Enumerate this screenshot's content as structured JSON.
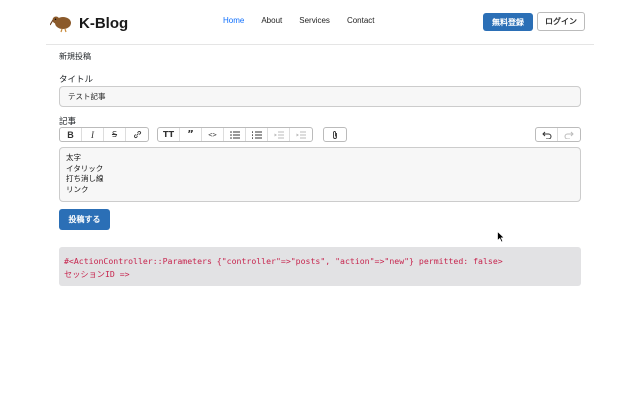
{
  "brand": {
    "name": "K-Blog",
    "logo_icon": "kiwi-bird-icon"
  },
  "nav": {
    "items": [
      {
        "label": "Home",
        "active": true
      },
      {
        "label": "About",
        "active": false
      },
      {
        "label": "Services",
        "active": false
      },
      {
        "label": "Contact",
        "active": false
      }
    ]
  },
  "auth": {
    "signup_label": "無料登録",
    "login_label": "ログイン"
  },
  "page": {
    "title": "新規投稿"
  },
  "form": {
    "title_label": "タイトル",
    "title_value": "テスト記事",
    "body_label": "記事",
    "body_lines": [
      "太字",
      "イタリック",
      "打ち消し線",
      "リンク"
    ],
    "submit_label": "投稿する"
  },
  "toolbar": {
    "groups": [
      [
        "bold-icon",
        "italic-icon",
        "strike-icon",
        "link-icon"
      ],
      [
        "heading-icon",
        "quote-icon",
        "code-icon",
        "bullet-list-icon",
        "number-list-icon",
        "outdent-icon",
        "indent-icon"
      ],
      [
        "attach-icon"
      ],
      [
        "undo-icon",
        "redo-icon"
      ]
    ]
  },
  "debug": {
    "line1": "#<ActionController::Parameters {\"controller\"=>\"posts\", \"action\"=>\"new\"} permitted: false>",
    "line2": "セッションID =>"
  },
  "colors": {
    "primary": "#2b6fb6",
    "nav_active": "#0d6efd",
    "debug_text": "#c7254e",
    "debug_bg": "#e2e2e4"
  }
}
